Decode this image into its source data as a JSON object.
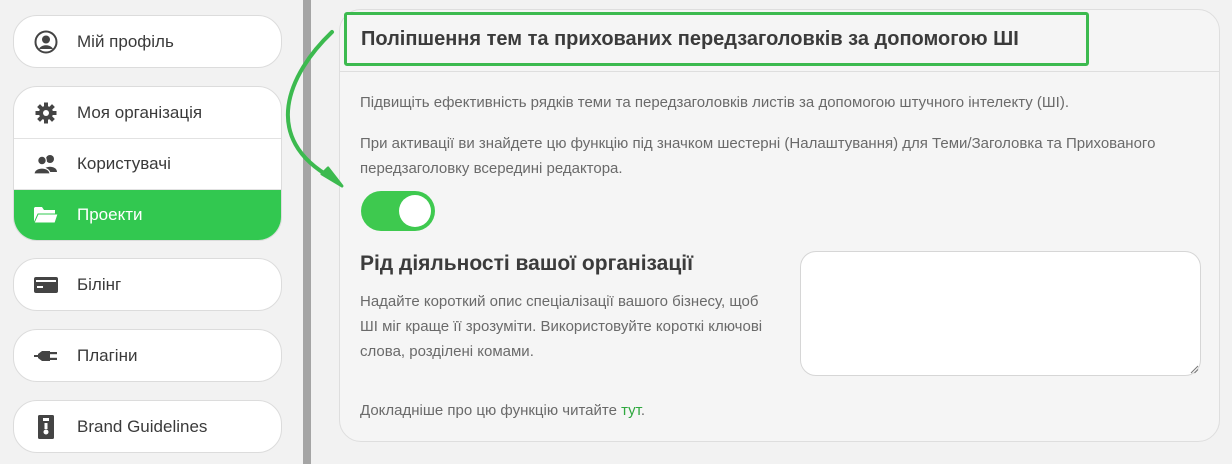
{
  "sidebar": {
    "profile": {
      "label": "Мій профіль",
      "icon": "user-circle-icon"
    },
    "org_group": [
      {
        "label": "Моя організація",
        "icon": "gear-icon",
        "active": false
      },
      {
        "label": "Користувачі",
        "icon": "users-icon",
        "active": false
      },
      {
        "label": "Проекти",
        "icon": "folder-icon",
        "active": true
      }
    ],
    "billing": {
      "label": "Білінг",
      "icon": "credit-card-icon"
    },
    "plugins": {
      "label": "Плагіни",
      "icon": "plug-icon"
    },
    "brand": {
      "label": "Brand Guidelines",
      "icon": "document-icon"
    }
  },
  "panel": {
    "title": "Поліпшення тем та прихованих передзаголовків за допомогою ШІ",
    "description_1": "Підвищіть ефективність рядків теми та передзаголовків листів за допомогою штучного інтелекту (ШІ).",
    "description_2": "При активації ви знайдете цю функцію під значком шестерні (Налаштування) для Теми/Заголовка та Прихованого передзаголовку всередині редактора.",
    "toggle_on": true,
    "business": {
      "title": "Рід діяльності вашої організації",
      "help": "Надайте короткий опис спеціалізації вашого бізнесу, щоб ШІ міг краще її зрозуміти. Використовуйте короткі ключові слова, розділені комами.",
      "value": ""
    },
    "more_info_prefix": "Докладніше про цю функцію читайте ",
    "more_info_link": "тут",
    "more_info_suffix": "."
  },
  "colors": {
    "accent": "#32c850",
    "highlight": "#3cba4f",
    "link": "#2fa83f"
  }
}
